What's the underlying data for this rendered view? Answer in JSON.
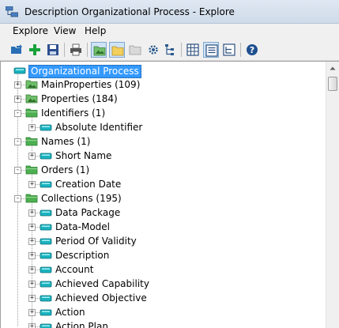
{
  "window": {
    "title": "Description Organizational Process - Explore"
  },
  "menu": [
    "Explore",
    "View",
    "Help"
  ],
  "toolbar": [
    {
      "icon": "open-folder-icon"
    },
    {
      "icon": "add-icon"
    },
    {
      "icon": "save-icon"
    },
    {
      "icon": "print-icon"
    },
    {
      "icon": "image-folder-icon",
      "pressed": true
    },
    {
      "icon": "folder-icon",
      "pressed": true
    },
    {
      "icon": "folder-gray-icon"
    },
    {
      "icon": "settings-icon"
    },
    {
      "icon": "hierarchy-icon"
    },
    {
      "icon": "grid-icon"
    },
    {
      "icon": "list-icon",
      "pressed": true
    },
    {
      "icon": "tree-view-icon"
    },
    {
      "icon": "help-icon"
    }
  ],
  "tree": {
    "root": "Organizational Process",
    "nodes": [
      {
        "label": "MainProperties (109)",
        "level": 1,
        "icon": "image-folder",
        "expander": "+"
      },
      {
        "label": "Properties (184)",
        "level": 1,
        "icon": "image-folder",
        "expander": "+"
      },
      {
        "label": "Identifiers (1)",
        "level": 1,
        "icon": "green-folder",
        "expander": "-"
      },
      {
        "label": "Absolute Identifier",
        "level": 2,
        "icon": "entity",
        "expander": "+"
      },
      {
        "label": "Names (1)",
        "level": 1,
        "icon": "green-folder",
        "expander": "-"
      },
      {
        "label": "Short Name",
        "level": 2,
        "icon": "entity",
        "expander": "+"
      },
      {
        "label": "Orders (1)",
        "level": 1,
        "icon": "green-folder",
        "expander": "-"
      },
      {
        "label": "Creation Date",
        "level": 2,
        "icon": "entity",
        "expander": "+"
      },
      {
        "label": "Collections (195)",
        "level": 1,
        "icon": "green-folder",
        "expander": "-"
      },
      {
        "label": "Data Package",
        "level": 2,
        "icon": "entity",
        "expander": "+"
      },
      {
        "label": "Data-Model",
        "level": 2,
        "icon": "entity",
        "expander": "+"
      },
      {
        "label": "Period Of Validity",
        "level": 2,
        "icon": "entity",
        "expander": "+"
      },
      {
        "label": "Description",
        "level": 2,
        "icon": "entity",
        "expander": "+"
      },
      {
        "label": "Account",
        "level": 2,
        "icon": "entity",
        "expander": "+"
      },
      {
        "label": "Achieved Capability",
        "level": 2,
        "icon": "entity",
        "expander": "+"
      },
      {
        "label": "Achieved Objective",
        "level": 2,
        "icon": "entity",
        "expander": "+"
      },
      {
        "label": "Action",
        "level": 2,
        "icon": "entity",
        "expander": "+"
      },
      {
        "label": "Action Plan",
        "level": 2,
        "icon": "entity",
        "expander": "+"
      }
    ]
  },
  "colors": {
    "selection": "#3399ff",
    "folder_green": "#4caf50",
    "entity_teal": "#19b3c0"
  }
}
